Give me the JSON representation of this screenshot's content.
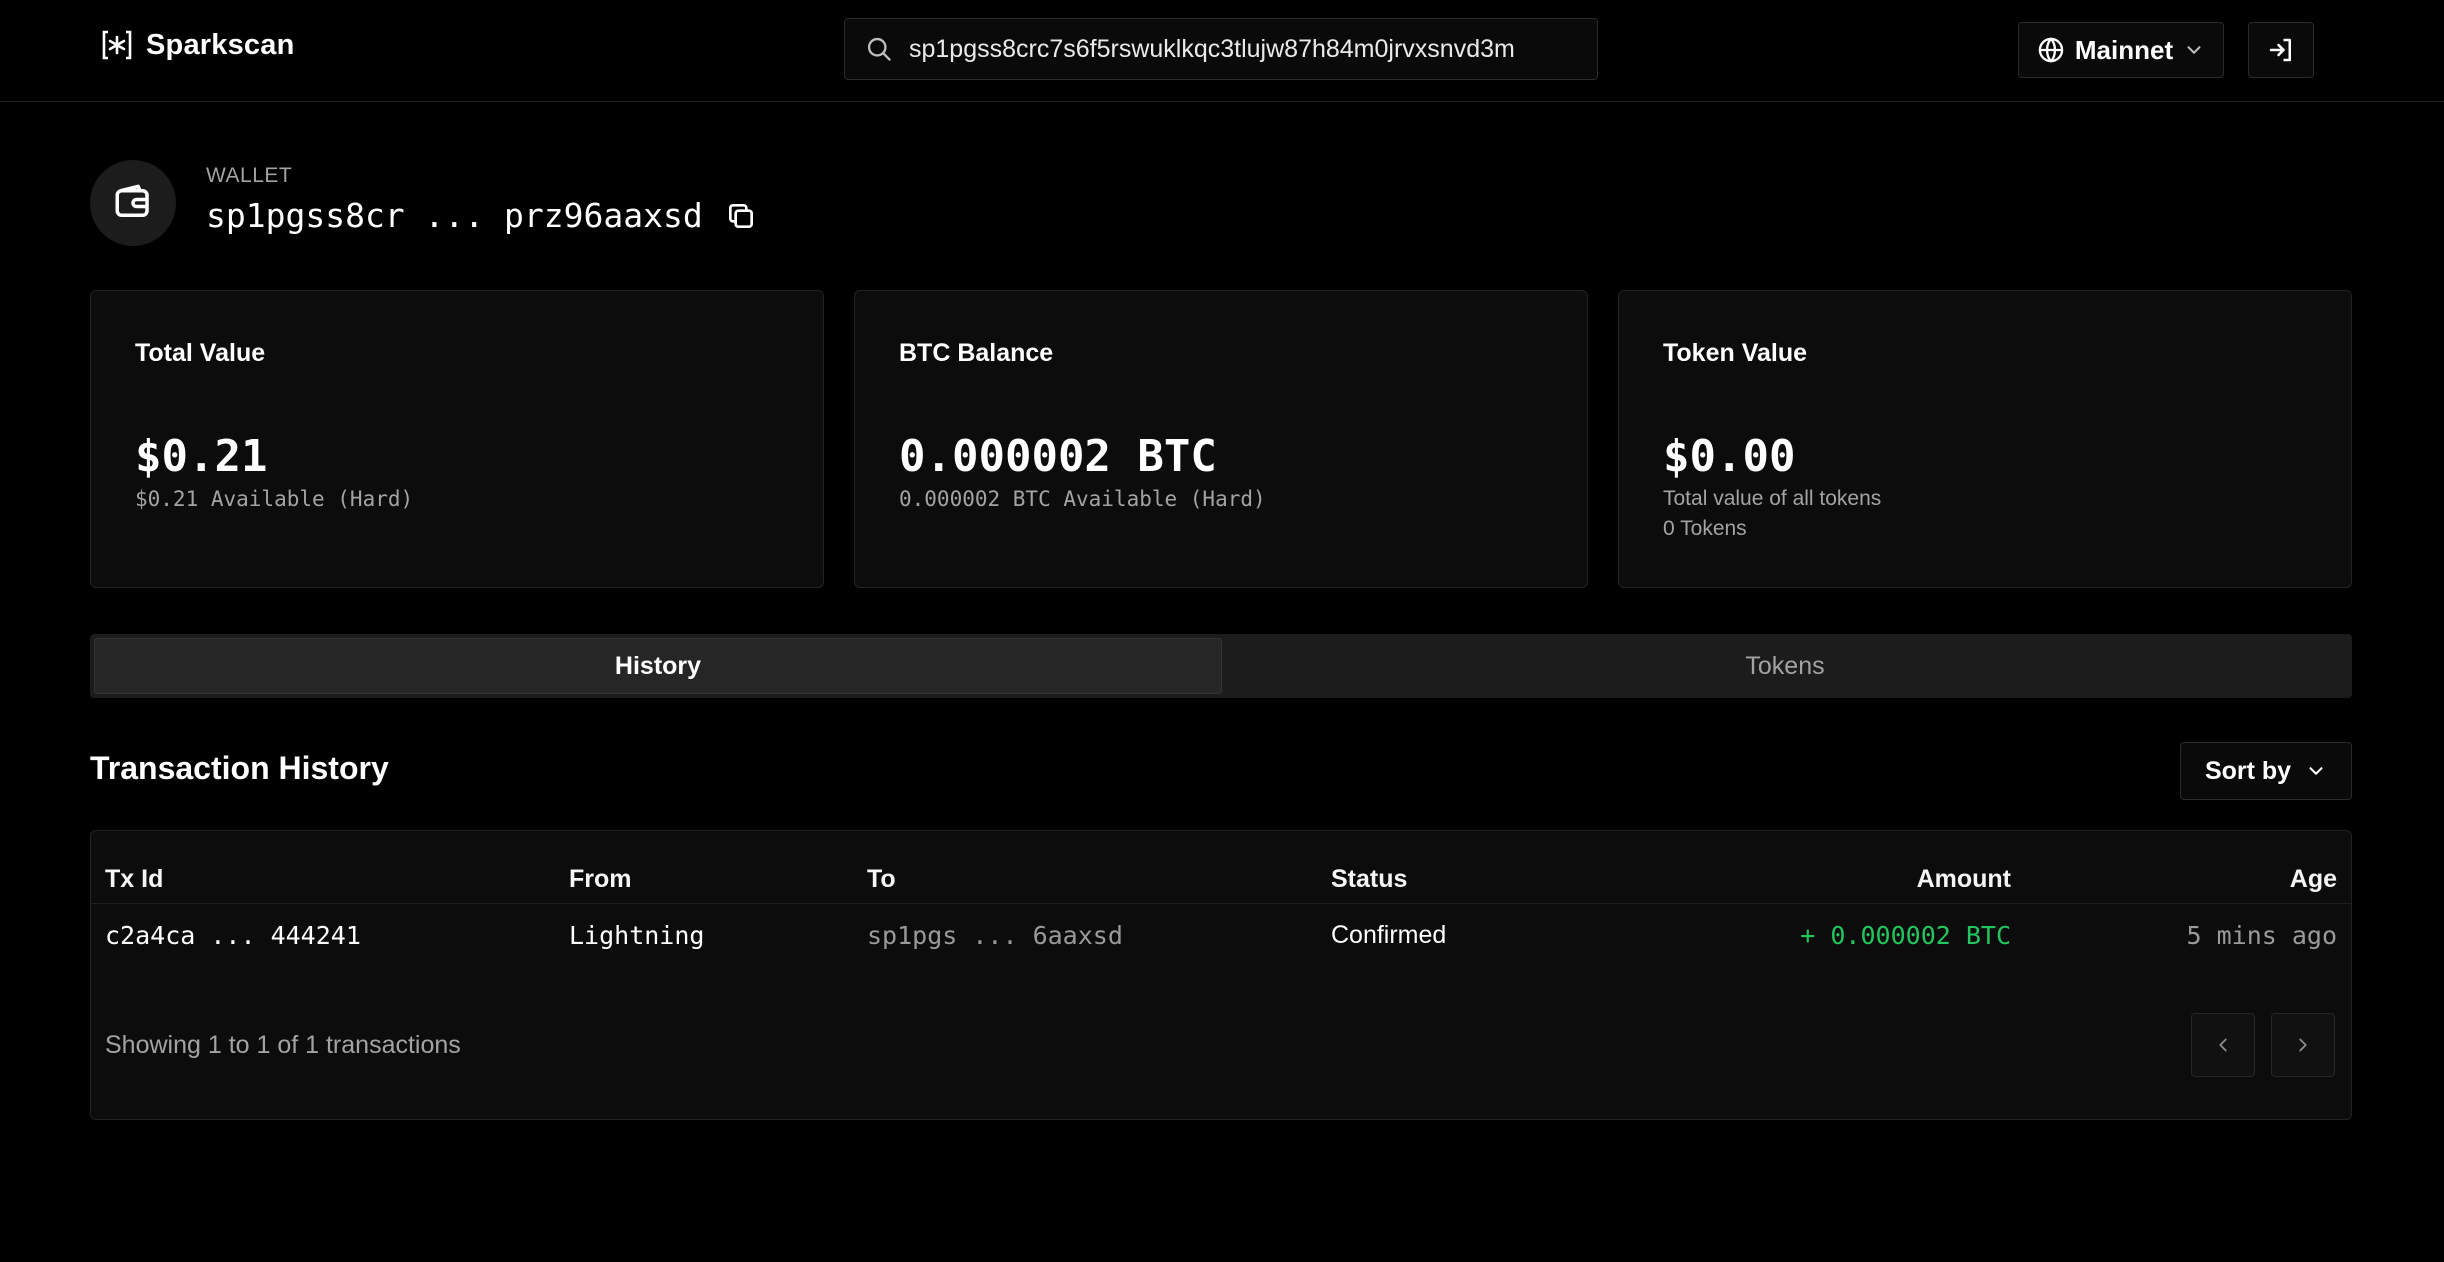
{
  "header": {
    "brand": "Sparkscan",
    "search_value": "sp1pgss8crc7s6f5rswuklkqc3tlujw87h84m0jrvxsnvd3m",
    "network_label": "Mainnet"
  },
  "wallet": {
    "label": "WALLET",
    "address": "sp1pgss8cr ... prz96aaxsd"
  },
  "cards": [
    {
      "title": "Total Value",
      "value": "$0.21",
      "sub": "$0.21 Available (Hard)"
    },
    {
      "title": "BTC Balance",
      "value": "0.000002 BTC",
      "sub": "0.000002 BTC Available (Hard)"
    },
    {
      "title": "Token Value",
      "value": "$0.00",
      "sub": "Total value of all tokens",
      "sub2": "0 Tokens"
    }
  ],
  "tabs": [
    "History",
    "Tokens"
  ],
  "transactions": {
    "title": "Transaction History",
    "sort_label": "Sort by",
    "columns": [
      "Tx Id",
      "From",
      "To",
      "Status",
      "Amount",
      "Age"
    ],
    "rows": [
      {
        "tx_id": "c2a4ca ... 444241",
        "from": "Lightning",
        "to": "sp1pgs ... 6aaxsd",
        "status": "Confirmed",
        "amount": "+ 0.000002 BTC",
        "age": "5 mins ago"
      }
    ],
    "showing": "Showing 1 to 1 of 1 transactions"
  },
  "colors": {
    "background": "#000000",
    "card": "#0c0c0c",
    "positive": "#22c55e"
  },
  "icons": [
    "sparkscan-logo-icon",
    "search-icon",
    "globe-icon",
    "chevron-down-icon",
    "login-icon",
    "wallet-icon",
    "copy-icon",
    "chevron-left-icon",
    "chevron-right-icon"
  ]
}
